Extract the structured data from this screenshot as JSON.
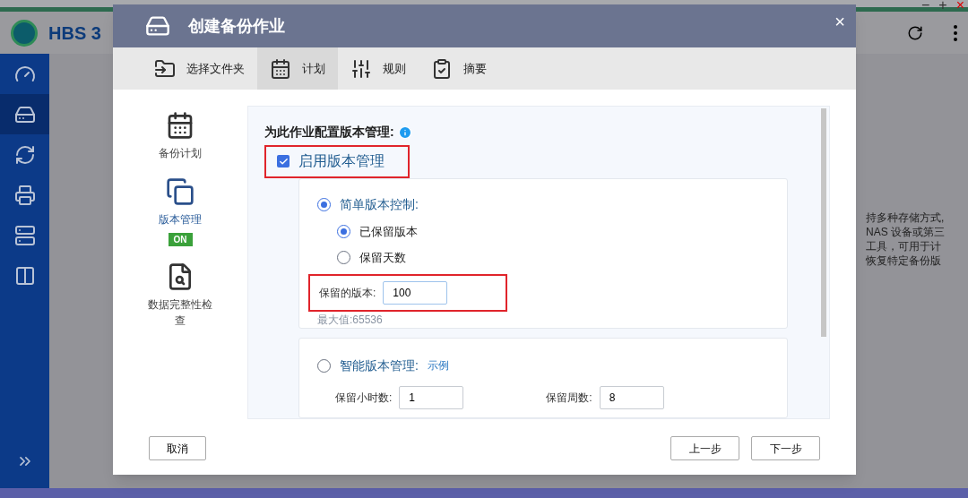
{
  "app": {
    "title": "HBS 3",
    "sidebar": [
      {
        "selected": false
      },
      {
        "selected": true
      },
      {
        "selected": false
      },
      {
        "selected": false
      },
      {
        "selected": false
      },
      {
        "selected": false
      }
    ],
    "window_controls": [
      "−",
      "+",
      "×"
    ],
    "background_text": [
      "持多种存储方式,",
      "NAS 设备或第三",
      "工具，可用于计",
      "恢复特定备份版"
    ]
  },
  "dialog": {
    "title": "创建备份作业",
    "close": "×",
    "steps": [
      {
        "label": "选择文件夹",
        "selected": false
      },
      {
        "label": "计划",
        "selected": true
      },
      {
        "label": "规则",
        "selected": false
      },
      {
        "label": "摘要",
        "selected": false
      }
    ],
    "sections": [
      {
        "label": "备份计划",
        "selected": false
      },
      {
        "label": "版本管理",
        "selected": true,
        "badge": "ON"
      },
      {
        "label": "数据完整性检查",
        "selected": false
      }
    ],
    "heading": "为此作业配置版本管理:",
    "enable": {
      "label": "启用版本管理",
      "checked": true
    },
    "simple": {
      "label": "简单版本控制:",
      "selected": true,
      "options": [
        {
          "label": "已保留版本",
          "selected": true
        },
        {
          "label": "保留天数",
          "selected": false
        }
      ],
      "field": {
        "label": "保留的版本:",
        "value": "100"
      },
      "hint": "最大值:65536"
    },
    "smart": {
      "label": "智能版本管理:",
      "selected": false,
      "link": "示例",
      "fields": [
        {
          "label": "保留小时数:",
          "value": "1"
        },
        {
          "label": "保留周数:",
          "value": "8"
        }
      ]
    },
    "buttons": {
      "cancel": "取消",
      "back": "上一步",
      "next": "下一步"
    }
  }
}
